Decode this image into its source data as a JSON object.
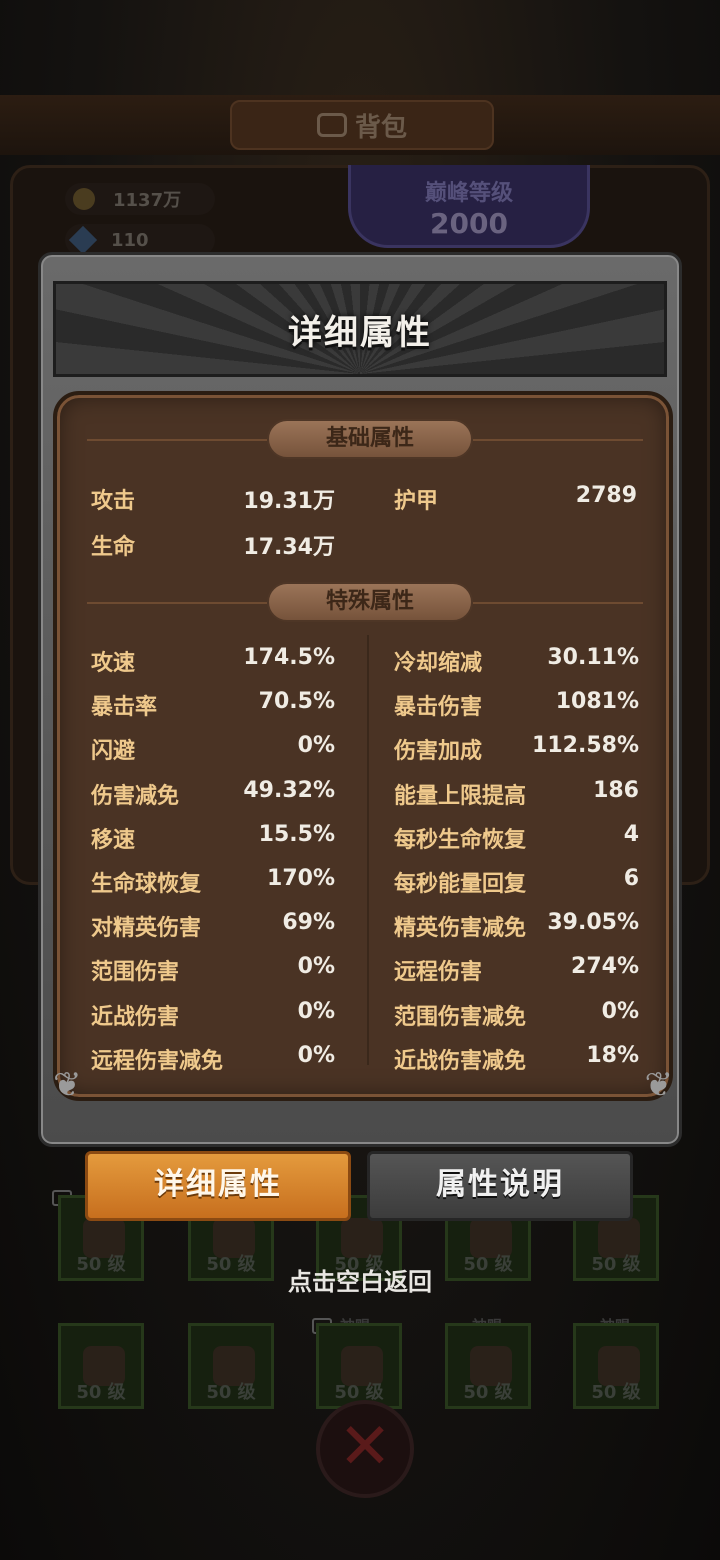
{
  "background": {
    "title": "背包",
    "gold": "1137万",
    "gems": "110",
    "peak_label": "巅峰等级",
    "peak_value": "2000",
    "slot_level": "50 级",
    "slot_tag": "神赐"
  },
  "modal": {
    "title": "详细属性",
    "basic_section": "基础属性",
    "special_section": "特殊属性",
    "basic_stats": [
      {
        "label": "攻击",
        "value": "19.31万"
      },
      {
        "label": "护甲",
        "value": "2789"
      },
      {
        "label": "生命",
        "value": "17.34万"
      }
    ],
    "special_left": [
      {
        "label": "攻速",
        "value": "174.5%"
      },
      {
        "label": "暴击率",
        "value": "70.5%"
      },
      {
        "label": "闪避",
        "value": "0%"
      },
      {
        "label": "伤害减免",
        "value": "49.32%"
      },
      {
        "label": "移速",
        "value": "15.5%"
      },
      {
        "label": "生命球恢复",
        "value": "170%"
      },
      {
        "label": "对精英伤害",
        "value": "69%"
      },
      {
        "label": "范围伤害",
        "value": "0%"
      },
      {
        "label": "近战伤害",
        "value": "0%"
      },
      {
        "label": "远程伤害减免",
        "value": "0%"
      }
    ],
    "special_right": [
      {
        "label": "冷却缩减",
        "value": "30.11%"
      },
      {
        "label": "暴击伤害",
        "value": "1081%"
      },
      {
        "label": "伤害加成",
        "value": "112.58%"
      },
      {
        "label": "能量上限提高",
        "value": "186"
      },
      {
        "label": "每秒生命恢复",
        "value": "4"
      },
      {
        "label": "每秒能量回复",
        "value": "6"
      },
      {
        "label": "精英伤害减免",
        "value": "39.05%"
      },
      {
        "label": "远程伤害",
        "value": "274%"
      },
      {
        "label": "范围伤害减免",
        "value": "0%"
      },
      {
        "label": "近战伤害减免",
        "value": "18%"
      }
    ]
  },
  "tabs": {
    "detail": "详细属性",
    "explain": "属性说明"
  },
  "hint": "点击空白返回"
}
